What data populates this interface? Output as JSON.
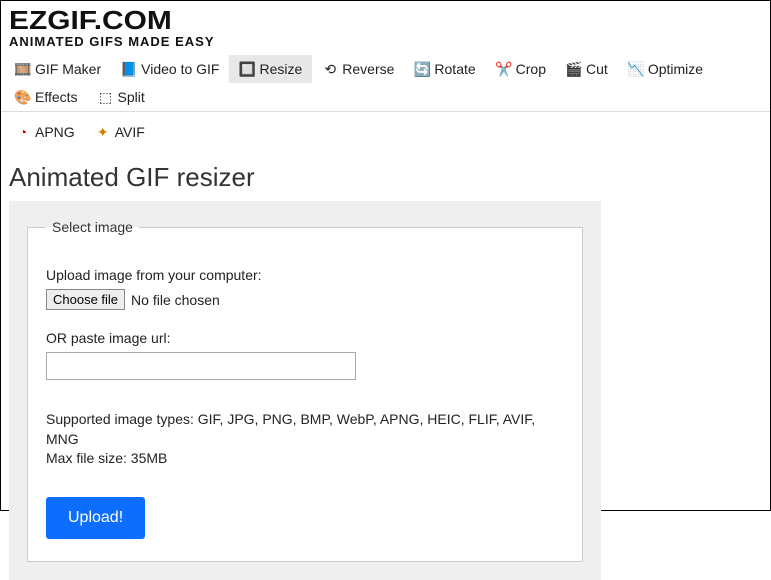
{
  "logo": {
    "main": "EZGIF.COM",
    "sub": "ANIMATED GIFS MADE EASY"
  },
  "nav": [
    {
      "label": "GIF Maker",
      "icon": "🎞️",
      "name": "gif-maker"
    },
    {
      "label": "Video to GIF",
      "icon": "📘",
      "name": "video-to-gif"
    },
    {
      "label": "Resize",
      "icon": "🔲",
      "name": "resize",
      "active": true
    },
    {
      "label": "Reverse",
      "icon": "⟲",
      "name": "reverse"
    },
    {
      "label": "Rotate",
      "icon": "🔄",
      "name": "rotate"
    },
    {
      "label": "Crop",
      "icon": "✂️",
      "name": "crop"
    },
    {
      "label": "Cut",
      "icon": "🎬",
      "name": "cut"
    },
    {
      "label": "Optimize",
      "icon": "📉",
      "name": "optimize"
    },
    {
      "label": "Effects",
      "icon": "🎨",
      "name": "effects"
    },
    {
      "label": "Split",
      "icon": "⬚",
      "name": "split"
    }
  ],
  "nav2": [
    {
      "label": "APNG",
      "icon": "◔",
      "iconColor": "#d00",
      "name": "apng"
    },
    {
      "label": "AVIF",
      "icon": "✦",
      "iconColor": "#d08000",
      "name": "avif"
    }
  ],
  "page": {
    "title": "Animated GIF resizer",
    "legend": "Select image",
    "uploadLabel": "Upload image from your computer:",
    "chooseFile": "Choose file",
    "fileStatus": "No file chosen",
    "orPaste": "OR paste image url:",
    "urlValue": "",
    "supported": "Supported image types: GIF, JPG, PNG, BMP, WebP, APNG, HEIC, FLIF, AVIF, MNG",
    "maxSize": "Max file size: 35MB",
    "uploadBtn": "Upload!"
  }
}
